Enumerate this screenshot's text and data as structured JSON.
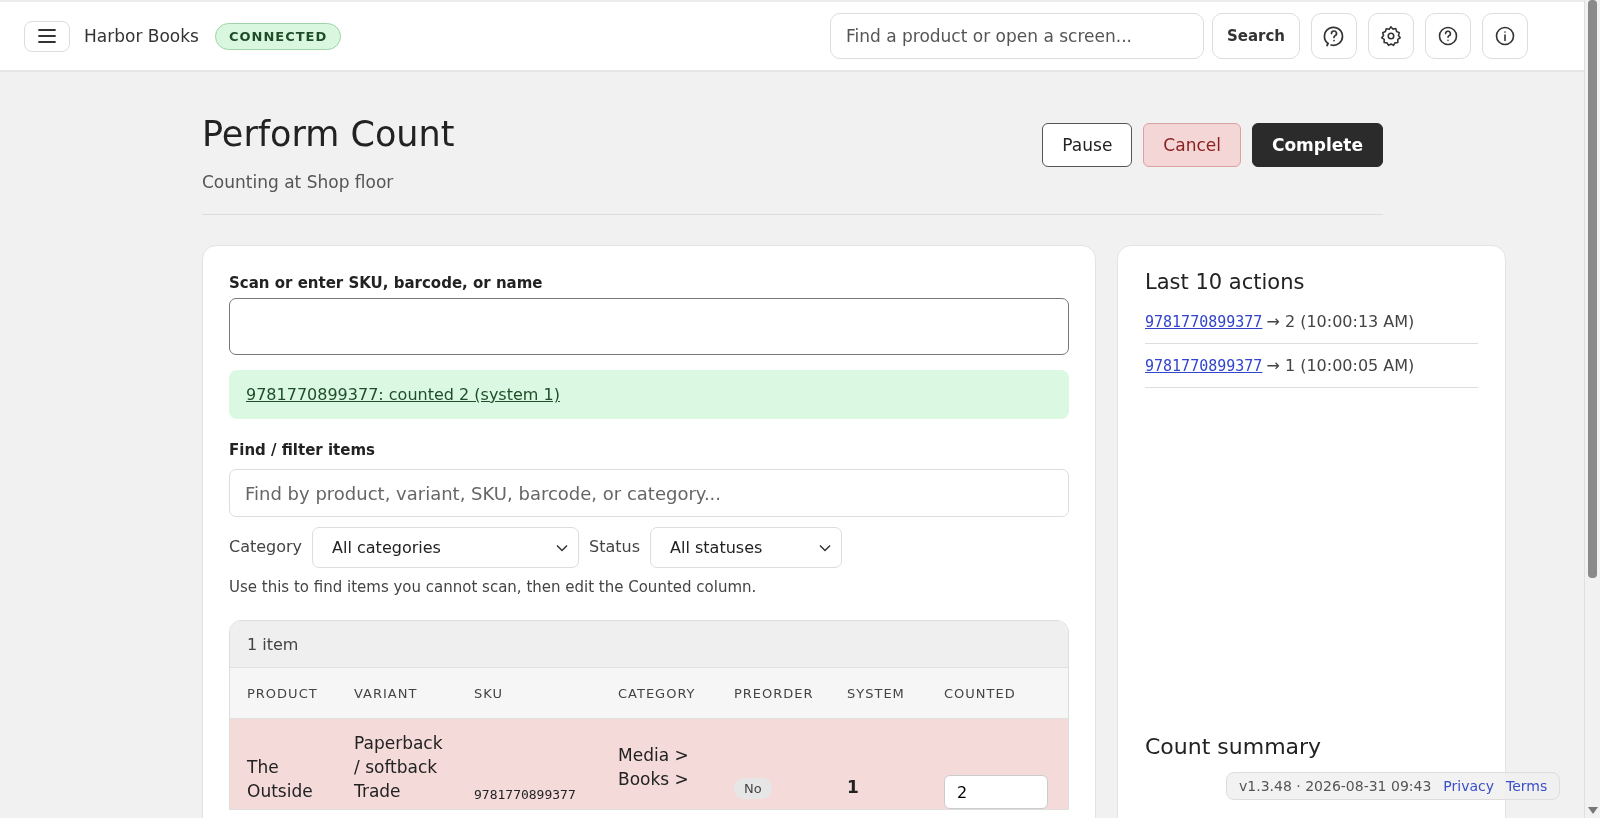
{
  "topbar": {
    "brand": "Harbor Books",
    "status_badge": "CONNECTED",
    "search": {
      "placeholder": "Find a product or open a screen..."
    },
    "search_button": "Search"
  },
  "page": {
    "title": "Perform Count",
    "subtitle": "Counting at Shop floor",
    "actions": [
      {
        "label": "Pause",
        "kind": "secondary"
      },
      {
        "label": "Cancel",
        "kind": "danger"
      },
      {
        "label": "Complete",
        "kind": "primary"
      }
    ]
  },
  "scan": {
    "label": "Scan or enter SKU, barcode, or name",
    "message": "9781770899377: counted 2 (system 1)"
  },
  "filter": {
    "label": "Find / filter items",
    "placeholder": "Find by product, variant, SKU, barcode, or category...",
    "category_label": "Category",
    "category_value": "All categories",
    "status_label": "Status",
    "status_value": "All statuses",
    "hint": "Use this to find items you cannot scan, then edit the Counted column."
  },
  "table": {
    "count": "1 item",
    "columns": [
      "PRODUCT",
      "VARIANT",
      "SKU",
      "CATEGORY",
      "PREORDER",
      "SYSTEM",
      "COUNTED"
    ],
    "rows": [
      {
        "product": "The Outside",
        "variant": "Paperback / softback Trade",
        "sku": "9781770899377",
        "category": "Media > Books >",
        "preorder": "No",
        "system": "1",
        "counted": "2",
        "mismatch": true
      }
    ]
  },
  "actions_panel": {
    "title": "Last 10 actions",
    "items": [
      {
        "sku": "9781770899377",
        "text": "→ 2 (10:00:13 AM)"
      },
      {
        "sku": "9781770899377",
        "text": "→ 1 (10:00:05 AM)"
      }
    ],
    "summary_title": "Count summary"
  },
  "footer": {
    "version": "v1.3.48 · 2026-08-31 09:43",
    "links": [
      "Privacy",
      "Terms"
    ]
  }
}
